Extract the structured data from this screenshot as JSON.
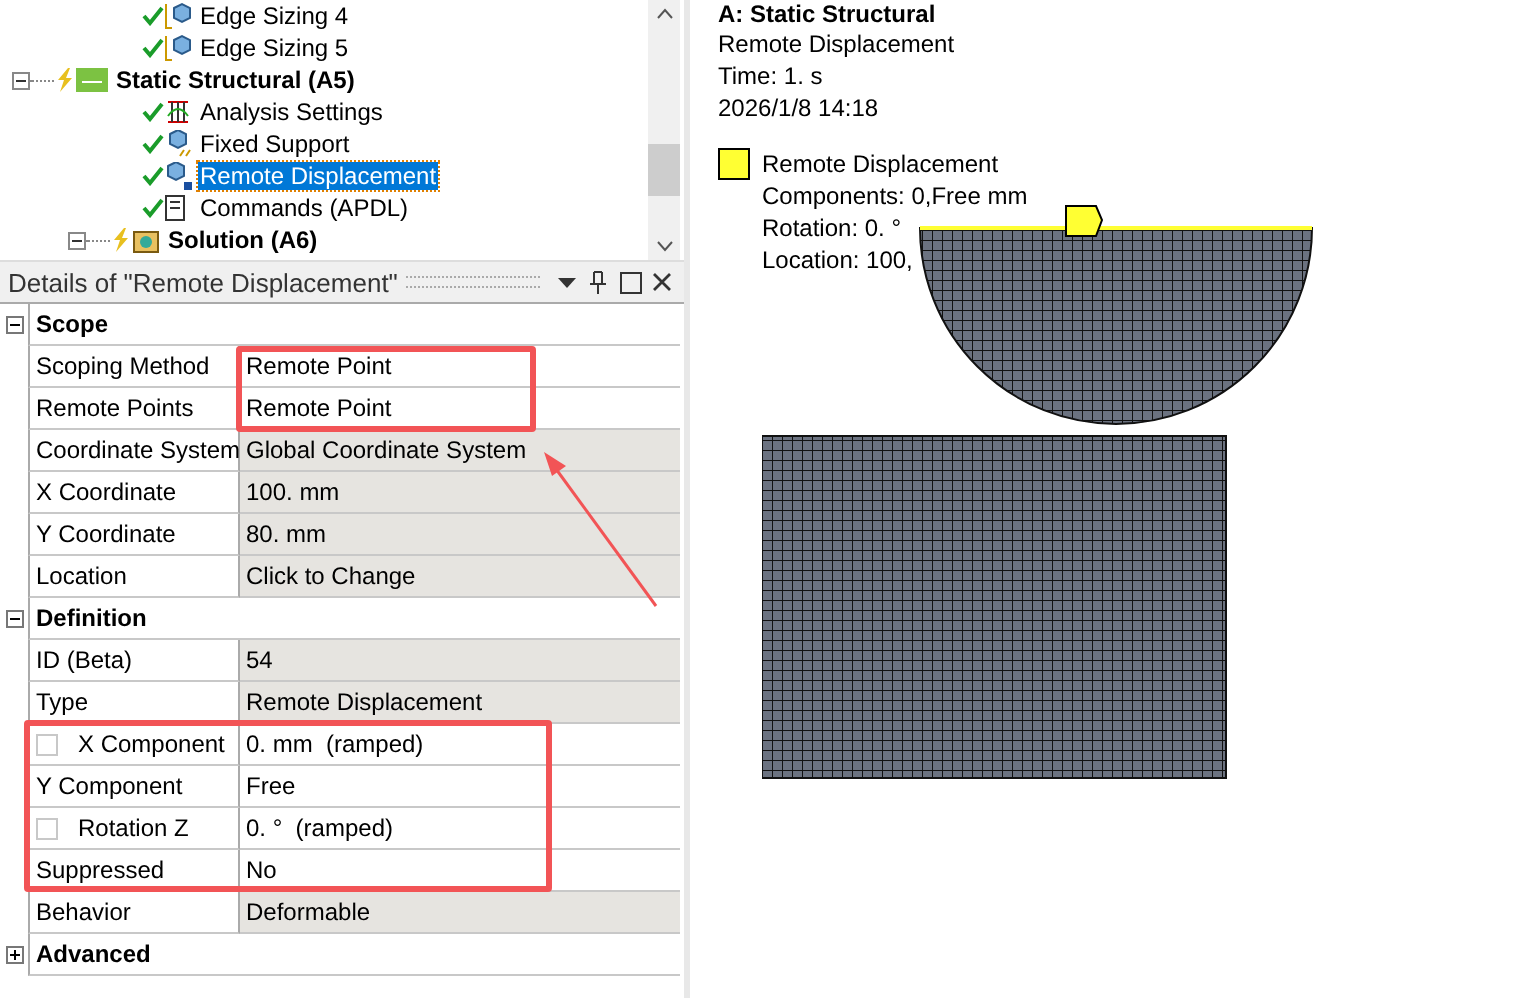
{
  "tree": {
    "continued_items": [
      {
        "label": "Edge Sizing 4",
        "kind": "sizing",
        "solved": true,
        "selected": false
      },
      {
        "label": "Edge Sizing 5",
        "kind": "sizing",
        "solved": true,
        "selected": false
      }
    ],
    "items": [
      {
        "label": "Static Structural (A5)",
        "kind": "structural",
        "solved": false,
        "selected": false,
        "expanded": true,
        "children": [
          {
            "label": "Analysis Settings",
            "kind": "analysis",
            "solved": true,
            "selected": false
          },
          {
            "label": "Fixed Support",
            "kind": "support",
            "solved": true,
            "selected": false
          },
          {
            "label": "Remote Displacement",
            "kind": "remote",
            "solved": true,
            "selected": true
          },
          {
            "label": "Commands (APDL)",
            "kind": "commands",
            "solved": true,
            "selected": false
          },
          {
            "label": "Solution (A6)",
            "kind": "solution",
            "solved": false,
            "selected": false,
            "expanded": true
          }
        ]
      }
    ]
  },
  "details": {
    "title": "Details of \"Remote Displacement\"",
    "sections": [
      {
        "title": "Scope",
        "expanded": true,
        "rows": [
          {
            "name": "Scoping Method",
            "value": "Remote Point",
            "editable": true
          },
          {
            "name": "Remote Points",
            "value": "Remote Point",
            "editable": true
          },
          {
            "name": "Coordinate System",
            "value": "Global Coordinate System",
            "editable": false
          },
          {
            "name": "X Coordinate",
            "value": "100. mm",
            "editable": false
          },
          {
            "name": "Y Coordinate",
            "value": "80. mm",
            "editable": false
          },
          {
            "name": "Location",
            "value": "Click to Change",
            "editable": false
          }
        ]
      },
      {
        "title": "Definition",
        "expanded": true,
        "rows": [
          {
            "name": "ID (Beta)",
            "value": "54",
            "editable": false
          },
          {
            "name": "Type",
            "value": "Remote Displacement",
            "editable": false
          },
          {
            "name": "X Component",
            "value": "0. mm  (ramped)",
            "editable": true,
            "kind": "checkbox",
            "checked": false
          },
          {
            "name": "Y Component",
            "value": "Free",
            "editable": true
          },
          {
            "name": "Rotation Z",
            "value": "0. °  (ramped)",
            "editable": true,
            "kind": "checkbox",
            "checked": false
          },
          {
            "name": "Suppressed",
            "value": "No",
            "editable": true
          },
          {
            "name": "Behavior",
            "value": "Deformable",
            "editable": false
          }
        ]
      },
      {
        "title": "Advanced",
        "expanded": false
      }
    ]
  },
  "viewport": {
    "title": "A: Static Structural",
    "lines": [
      "Remote Displacement",
      "Time: 1. s",
      "2026/1/8 14:18"
    ],
    "legend": {
      "label": "Remote Displacement",
      "color": "#ffff33",
      "lines": [
        "Components: 0,Free mm",
        "Rotation: 0. °",
        "Location: 100,"
      ]
    }
  }
}
